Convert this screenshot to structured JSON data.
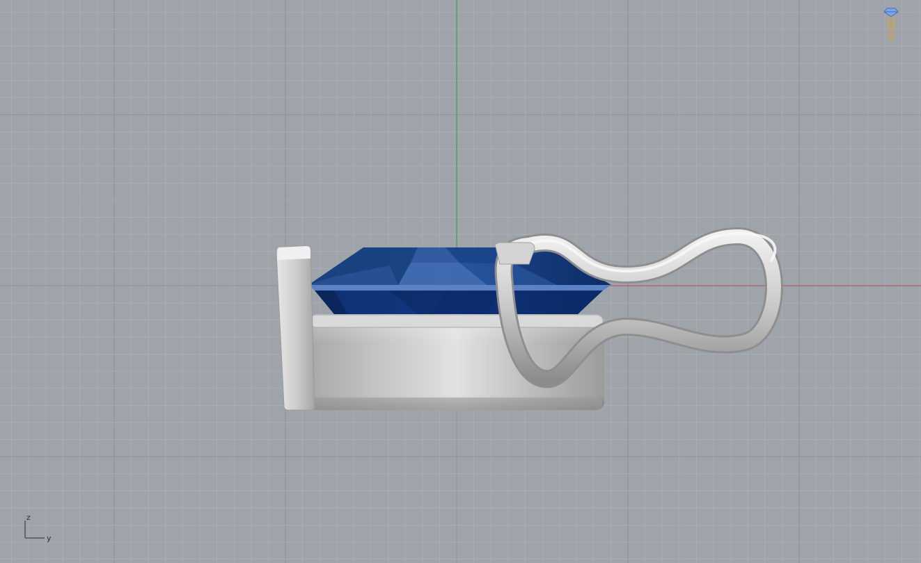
{
  "viewport": {
    "background": "#9ea4aa",
    "grid_minor_color": "#aab0b6",
    "grid_major_color": "#8a9096",
    "x_axis_color": "#b5495b",
    "y_axis_color": "#2e9a3e"
  },
  "scene": {
    "gem_color": "#0f2f6b",
    "gem_highlight": "#5a7fc0",
    "metal_color": "#c9c9c9",
    "metal_shadow": "#9a9a9a"
  },
  "axis_triad": {
    "z_label": "z",
    "y_label": "y"
  },
  "icons": {
    "corner_widget": "diamond-pen-icon"
  }
}
